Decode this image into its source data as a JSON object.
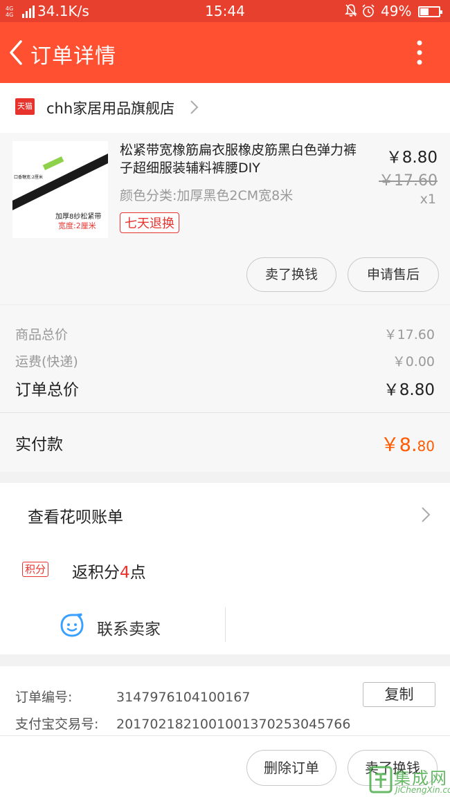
{
  "status_bar": {
    "network": "4G 4G",
    "speed": "34.1K/s",
    "time": "15:44",
    "battery": "49%",
    "battery_level": 0.49
  },
  "app_bar": {
    "title": "订单详情"
  },
  "shop": {
    "badge": "天猫",
    "name": "chh家居用品旗舰店"
  },
  "item": {
    "title": "松紧带宽橡筋扁衣服橡皮筋黑白色弹力裤子超细服装辅料裤腰DIY",
    "spec": "颜色分类:加厚黑色2CM宽8米",
    "tag": "七天退换",
    "price": "￥8.80",
    "original_price": "￥17.60",
    "quantity": "x1",
    "thumb_caption": "加厚8纱松紧带",
    "thumb_caption2": "宽度:2厘米",
    "thumb_label": "口香糖宽:2厘米",
    "sell_button": "卖了换钱",
    "aftersale_button": "申请售后"
  },
  "summary": {
    "goods_total_label": "商品总价",
    "goods_total": "￥17.60",
    "shipping_label": "运费(快递)",
    "shipping": "￥0.00",
    "order_total_label": "订单总价",
    "order_total": "￥8.80",
    "paid_label": "实付款",
    "paid_main": "￥8.",
    "paid_cents": "80"
  },
  "actions": {
    "huabei": "查看花呗账单",
    "jifen_badge": "积分",
    "jifen_prefix": "返积分",
    "jifen_num": "4",
    "jifen_suffix": "点",
    "contact": "联系卖家"
  },
  "order_info": {
    "order_no_label": "订单编号:",
    "order_no": "3147976104100167",
    "alipay_label": "支付宝交易号:",
    "alipay_no": "2017021821001001370253045766",
    "copy_button": "复制"
  },
  "bottom": {
    "delete_button": "删除订单",
    "sell_button": "卖了换钱"
  },
  "watermark": {
    "main": "集成网",
    "sub": "JiChengXin.com"
  },
  "colors": {
    "accent": "#ff5131",
    "price_orange": "#ff5a00",
    "tmall_red": "#e8332d"
  }
}
